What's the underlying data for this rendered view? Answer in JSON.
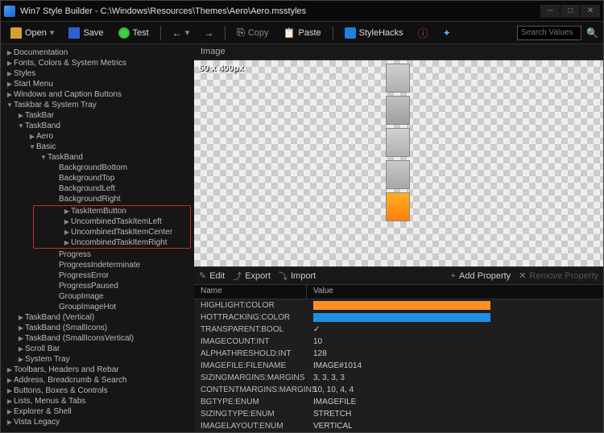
{
  "titlebar": "Win7 Style Builder - C:\\Windows\\Resources\\Themes\\Aero\\Aero.msstyles",
  "toolbar": {
    "open": "Open",
    "save": "Save",
    "test": "Test",
    "copy": "Copy",
    "paste": "Paste",
    "stylehacks": "StyleHacks"
  },
  "search_placeholder": "Search Values",
  "tree": {
    "t0": "Documentation",
    "t1": "Fonts, Colors & System Metrics",
    "t2": "Styles",
    "t3": "Start Menu",
    "t4": "Windows and Caption Buttons",
    "t5": "Taskbar & System Tray",
    "t5_0": "TaskBar",
    "t5_1": "TaskBand",
    "t5_1_0": "Aero",
    "t5_1_1": "Basic",
    "t5_1_1_0": "TaskBand",
    "bb": "BackgroundBottom",
    "bt": "BackgroundTop",
    "bl": "BackgroundLeft",
    "br": "BackgroundRight",
    "hi0": "TaskItemButton",
    "hi1": "UncombinedTaskItemLeft",
    "hi2": "UncombinedTaskItemCenter",
    "hi3": "UncombinedTaskItemRight",
    "pr": "Progress",
    "pri": "ProgressIndeterminate",
    "pre": "ProgressError",
    "prp": "ProgressPaused",
    "gi": "GroupImage",
    "gih": "GroupImageHot",
    "t5_2": "TaskBand (Vertical)",
    "t5_3": "TaskBand (SmallIcons)",
    "t5_4": "TaskBand (SmallIconsVertical)",
    "t5_5": "Scroll Bar",
    "t5_6": "System Tray",
    "t6": "Toolbars, Headers and Rebar",
    "t7": "Address, Breadcrumb & Search",
    "t8": "Buttons, Boxes & Controls",
    "t9": "Lists, Menus & Tabs",
    "t10": "Explorer & Shell",
    "t11": "Vista Legacy"
  },
  "image_section": "Image",
  "image_size": "60 x 400px",
  "prop_tools": {
    "edit": "Edit",
    "export": "Export",
    "import": "Import",
    "add": "Add Property",
    "remove": "Remove Property"
  },
  "prop_cols": {
    "name": "Name",
    "value": "Value"
  },
  "props": {
    "r0n": "HIGHLIGHT:COLOR",
    "r1n": "HOTTRACKING:COLOR",
    "r2n": "TRANSPARENT:BOOL",
    "r2v": "✓",
    "r3n": "IMAGECOUNT:INT",
    "r3v": "10",
    "r4n": "ALPHATHRESHOLD:INT",
    "r4v": "128",
    "r5n": "IMAGEFILE:FILENAME",
    "r5v": "IMAGE#1014",
    "r6n": "SIZINGMARGINS:MARGINS",
    "r6v": "3, 3, 3, 3",
    "r7n": "CONTENTMARGINS:MARGINS",
    "r7v": "10, 10, 4, 4",
    "r8n": "BGTYPE:ENUM",
    "r8v": "IMAGEFILE",
    "r9n": "SIZINGTYPE:ENUM",
    "r9v": "STRETCH",
    "r10n": "IMAGELAYOUT:ENUM",
    "r10v": "VERTICAL"
  },
  "colors": {
    "highlight": "#ff9020",
    "hottracking": "#2090e0"
  }
}
